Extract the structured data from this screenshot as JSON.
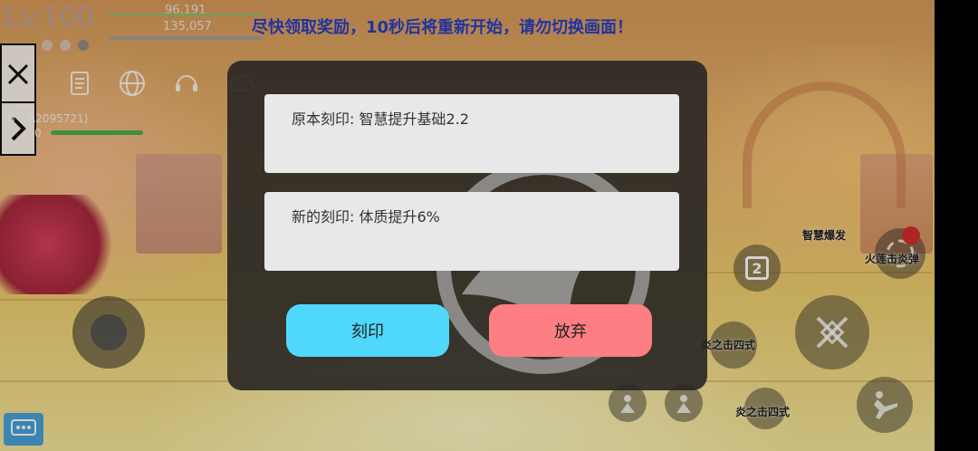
{
  "hud": {
    "level": "Lv.100",
    "stat_top": "96,191",
    "stat_bottom": "135,057",
    "notice": "尽快领取奖励，10秒后将重新开始，请勿切换画面！",
    "player_id": "A2095721)",
    "player_prefix": "N",
    "player_hp_text": "0"
  },
  "dialog": {
    "original_engraving": "原本刻印: 智慧提升基础2.2",
    "new_engraving": "新的刻印: 体质提升6%",
    "engrave_button": "刻印",
    "discard_button": "放弃"
  },
  "skills": {
    "wisdom_burst": "智慧爆发",
    "fire_lotus_bomb": "火莲击炎弹",
    "flame_four_style_1": "炎之击四式",
    "flame_four_style_2": "炎之击四式",
    "slot_number": "2"
  },
  "colors": {
    "engrave_button": "#4fd8fb",
    "discard_button": "#fd7f83",
    "notice_text": "#2a3fc4"
  }
}
